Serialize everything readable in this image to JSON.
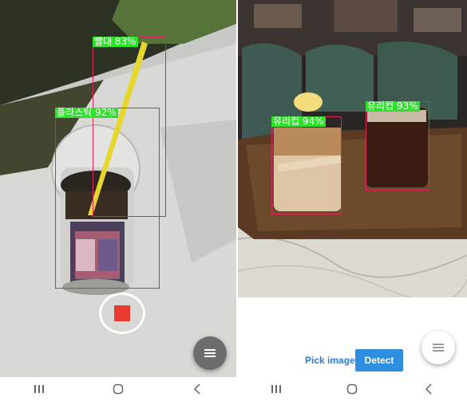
{
  "left_screen": {
    "detections": [
      {
        "label": "빨대 83%"
      },
      {
        "label": "플라스틱 92%"
      }
    ],
    "record_button": {
      "icon": "stop-square-icon",
      "color": "#ea3b32"
    },
    "fab": {
      "icon": "menu-icon"
    }
  },
  "right_screen": {
    "detections": [
      {
        "label": "유리컵 94%"
      },
      {
        "label": "유리컵 93%"
      }
    ],
    "buttons": {
      "pick_label": "Pick image",
      "detect_label": "Detect"
    },
    "fab": {
      "icon": "menu-icon"
    }
  },
  "nav": {
    "icons": [
      "recent-apps-icon",
      "home-icon",
      "back-icon"
    ]
  },
  "colors": {
    "box": "#e1245e",
    "label_bg": "#2fe12a",
    "detect_button": "#2d8ee0",
    "pick_text": "#2d7cd6"
  }
}
